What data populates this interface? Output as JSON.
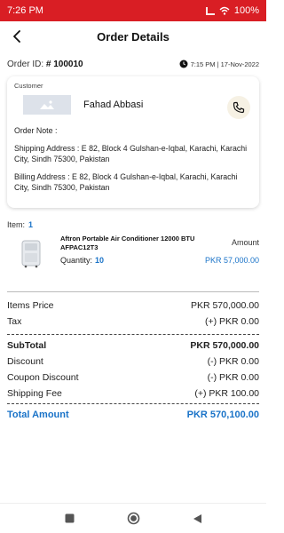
{
  "status_bar": {
    "time": "7:26 PM",
    "battery": "100%"
  },
  "header": {
    "title": "Order Details"
  },
  "order": {
    "id_label": "Order ID: ",
    "id_value": "# 100010",
    "time_date": "7:15 PM | 17-Nov-2022"
  },
  "customer": {
    "label": "Customer",
    "name": "Fahad Abbasi",
    "note": "Order Note :",
    "shipping": "Shipping Address : E 82, Block 4 Gulshan-e-Iqbal, Karachi, Karachi City, Sindh 75300, Pakistan",
    "billing": "Billing Address : E 82, Block 4 Gulshan-e-Iqbal, Karachi, Karachi City, Sindh 75300, Pakistan"
  },
  "items": {
    "label": "Item:",
    "count": "1"
  },
  "product": {
    "name": "Aftron Portable Air Conditioner 12000 BTU AFPAC12T3",
    "amount_label": "Amount",
    "qty_label": "Quantity:",
    "qty": "10",
    "price": "PKR 57,000.00"
  },
  "summary": {
    "items_price": {
      "label": "Items Price",
      "value": "PKR 570,000.00"
    },
    "tax": {
      "label": "Tax",
      "value": "(+) PKR 0.00"
    },
    "subtotal": {
      "label": "SubTotal",
      "value": "PKR 570,000.00"
    },
    "discount": {
      "label": "Discount",
      "value": "(-) PKR 0.00"
    },
    "coupon_discount": {
      "label": "Coupon Discount",
      "value": "(-) PKR 0.00"
    },
    "shipping_fee": {
      "label": "Shipping Fee",
      "value": "(+) PKR 100.00"
    },
    "total": {
      "label": "Total Amount",
      "value": "PKR 570,100.00"
    }
  },
  "colors": {
    "status_bar": "#d91e24",
    "accent": "#1a73c8"
  },
  "icons": {
    "back": "arrow-left-icon",
    "clock": "clock-icon",
    "avatar": "image-placeholder-icon",
    "phone": "phone-icon",
    "nav_recent": "square-icon",
    "nav_home": "circle-icon",
    "nav_back": "triangle-icon"
  }
}
